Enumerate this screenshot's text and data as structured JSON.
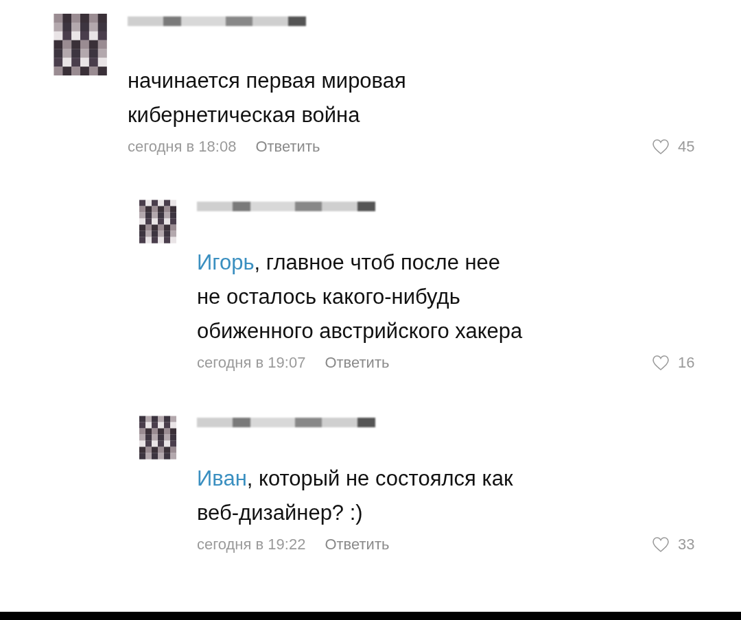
{
  "comments": [
    {
      "lines": [
        "начинается первая мировая",
        "кибернетическая война"
      ],
      "time": "сегодня в 18:08",
      "reply": "Ответить",
      "likes": "45",
      "liked": false,
      "children": [
        {
          "mention": "Игорь",
          "lines": [
            ", главное чтоб после нее",
            "не осталось какого-нибудь",
            "обиженного австрийского хакера"
          ],
          "time": "сегодня в 19:07",
          "reply": "Ответить",
          "likes": "16",
          "liked": false
        },
        {
          "mention": "Иван",
          "lines": [
            ", который не состоялся как",
            "веб-дизайнер? :)"
          ],
          "time": "сегодня в 19:22",
          "reply": "Ответить",
          "likes": "33",
          "liked": false
        }
      ]
    }
  ]
}
